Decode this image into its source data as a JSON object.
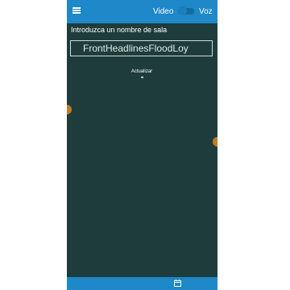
{
  "appbar": {
    "menu_icon": "hamburger-menu-icon",
    "video_label": "Video",
    "video_toggle_on": false,
    "voz_label": "Voz"
  },
  "room": {
    "prompt_label": "Introduzca un nombre de sala",
    "name_value": "FrontHeadlinesFloodLoy",
    "refresh_label": "Actualizar"
  },
  "bottombar": {
    "icon": "calendar-icon"
  },
  "colors": {
    "accent": "#1e88c8",
    "background": "#1f3c3c"
  }
}
